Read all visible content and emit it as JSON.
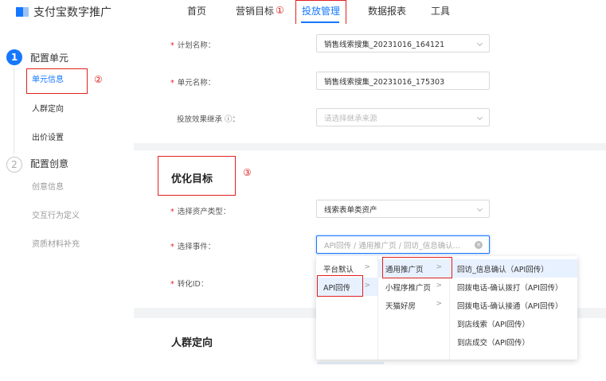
{
  "app": {
    "title": "支付宝数字推广"
  },
  "nav": {
    "items": [
      "首页",
      "营销目标",
      "投放管理",
      "数据报表",
      "工具"
    ],
    "active_index": 2
  },
  "annotations": {
    "c1": "①",
    "c2": "②",
    "c3": "③"
  },
  "sidebar": {
    "steps": [
      {
        "number": "1",
        "title": "配置单元",
        "items": [
          "单元信息",
          "人群定向",
          "出价设置"
        ],
        "active_item_index": 0
      },
      {
        "number": "2",
        "title": "配置创意",
        "items": [
          "创意信息",
          "交互行为定义",
          "资质材料补充"
        ]
      }
    ]
  },
  "form_top": {
    "plan_name": {
      "label": "计划名称：",
      "value": "销售线索搜集_20231016_164121"
    },
    "unit_name": {
      "label": "单元名称：",
      "value": "销售线索搜集_20231016_175303"
    },
    "inherit": {
      "label": "投放效果继承 ⓘ：",
      "placeholder": "请选择继承来源"
    }
  },
  "optimization": {
    "title": "优化目标",
    "asset_type": {
      "label": "选择资产类型：",
      "value": "线索表单类资产"
    },
    "event": {
      "label": "选择事件：",
      "value": "API回传 / 通用推广页 / 回访_信息确认..."
    },
    "conversion_id": {
      "label": "转化ID："
    }
  },
  "cascader": {
    "col1": [
      {
        "label": "平台默认",
        "has_children": true
      },
      {
        "label": "API回传",
        "has_children": true,
        "selected": true
      }
    ],
    "col2": [
      {
        "label": "通用推广页",
        "has_children": true,
        "selected": true
      },
      {
        "label": "小程序推广页",
        "has_children": true
      },
      {
        "label": "天猫好房",
        "has_children": true
      }
    ],
    "col3": [
      {
        "label": "回访_信息确认（API回传）",
        "selected": true
      },
      {
        "label": "回拨电话-确认拨打（API回传）"
      },
      {
        "label": "回拨电话-确认接通（API回传）"
      },
      {
        "label": "到店线索（API回传）"
      },
      {
        "label": "到店成交（API回传）"
      }
    ]
  },
  "audience": {
    "title": "人群定向"
  },
  "colors": {
    "accent": "#1677ff",
    "annotation": "#e02020",
    "required": "#e02020"
  }
}
